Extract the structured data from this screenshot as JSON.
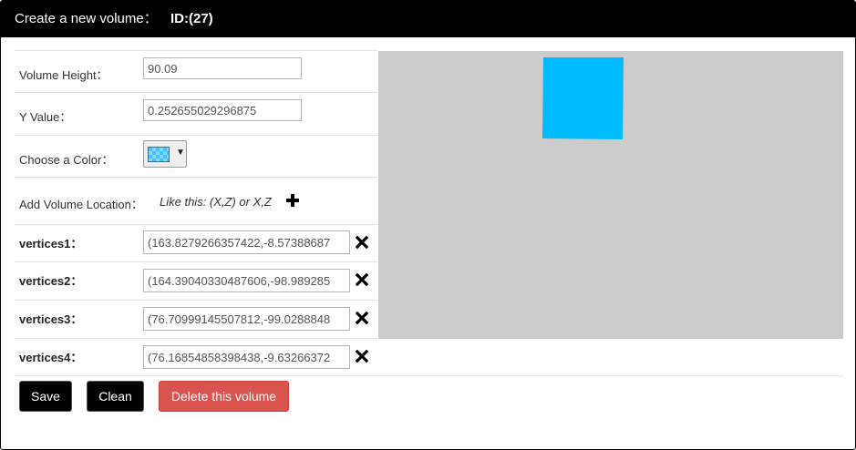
{
  "dialog": {
    "title": "Create a new volume：",
    "id_label": "ID:(27)"
  },
  "form": {
    "height_label": "Volume Height：",
    "height_value": "90.09",
    "y_label": "Y Value：",
    "y_value": "0.252655029296875",
    "color_label": "Choose a Color：",
    "color_value": "#42c3ff",
    "location_label": "Add Volume Location：",
    "location_hint": "Like this: (X,Z) or X,Z",
    "vertices": [
      {
        "label": "vertices1：",
        "value": "(163.8279266357422,-8.57388687"
      },
      {
        "label": "vertices2：",
        "value": "(164.39040330487606,-98.989285"
      },
      {
        "label": "vertices3：",
        "value": "(76.70999145507812,-99.0288848"
      },
      {
        "label": "vertices4：",
        "value": "(76.16854858398438,-9.63266372"
      }
    ]
  },
  "canvas": {
    "background": "#cccccc",
    "shape_color": "#00bbff"
  },
  "buttons": {
    "save": "Save",
    "clean": "Clean",
    "delete": "Delete this volume"
  },
  "icons": {
    "add": "plus-icon",
    "remove": "x-icon"
  }
}
